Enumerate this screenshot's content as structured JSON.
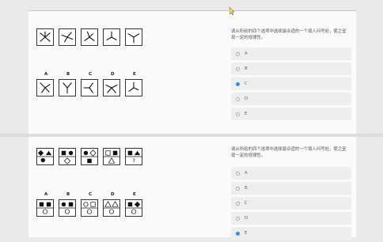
{
  "panels": [
    {
      "question": "请从所给的四个选项中选择最合适的一个填入问号处，使之呈现一定的规律性。",
      "options": [
        {
          "label": "A",
          "selected": false
        },
        {
          "label": "B",
          "selected": false
        },
        {
          "label": "C",
          "selected": true
        },
        {
          "label": "D",
          "selected": false
        },
        {
          "label": "E",
          "selected": false
        }
      ],
      "answer_labels": [
        "A",
        "B",
        "C",
        "D",
        "E"
      ]
    },
    {
      "question": "请从所给的四个选项中选择最合适的一个填入问号处，使之呈现一定的规律性。",
      "options": [
        {
          "label": "A",
          "selected": false
        },
        {
          "label": "B",
          "selected": false
        },
        {
          "label": "C",
          "selected": false
        },
        {
          "label": "D",
          "selected": false
        },
        {
          "label": "E",
          "selected": true
        }
      ],
      "answer_labels": [
        "A",
        "B",
        "C",
        "D",
        "E"
      ]
    }
  ],
  "colors": {
    "accent": "#3b8ed6"
  }
}
